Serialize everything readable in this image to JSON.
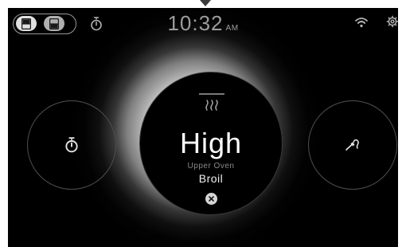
{
  "header": {
    "oven_toggle": {
      "segments": [
        "upper-oven",
        "lower-oven"
      ],
      "selected": "upper-oven"
    },
    "timer_icon": "stopwatch-icon",
    "clock": {
      "time": "10:32",
      "ampm": "AM"
    },
    "wifi_icon": "wifi-icon",
    "settings_icon": "gear-icon"
  },
  "controls": {
    "left": {
      "icon": "stopwatch-icon"
    },
    "right": {
      "icon": "probe-icon"
    }
  },
  "main": {
    "heat_icon": "heat-waves-icon",
    "level": "High",
    "zone": "Upper Oven",
    "mode": "Broil",
    "cancel_icon": "close-icon"
  },
  "colors": {
    "background": "#000000",
    "glow": "#ffffff",
    "clock_text": "#9c9c9c",
    "icon_gray": "#b8b8b8"
  }
}
